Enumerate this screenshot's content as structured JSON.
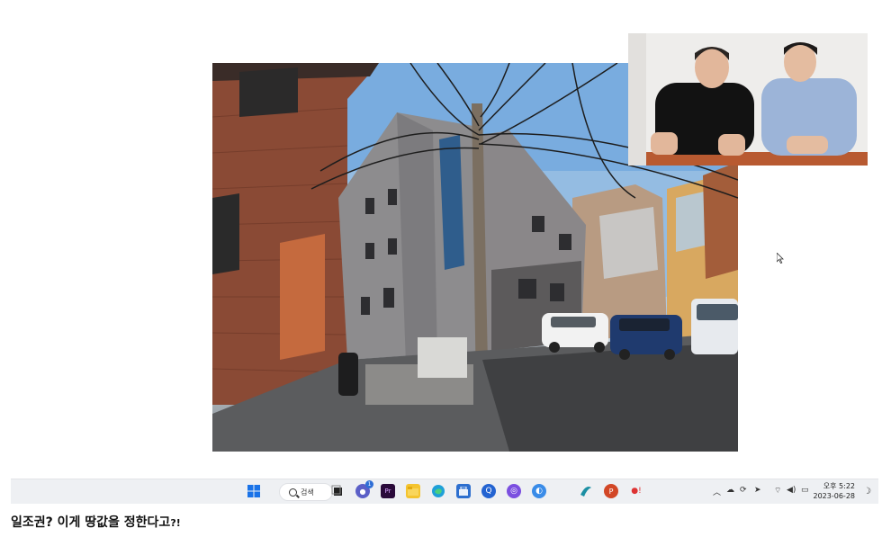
{
  "taskbar": {
    "search_label": "검색",
    "chat_badge": "1",
    "clock_time": "오후 5:22",
    "clock_date": "2023-06-28",
    "apps": [
      "windows-start",
      "search",
      "task-view",
      "chat",
      "premiere-pro",
      "file-explorer",
      "edge",
      "microsoft-store",
      "app-blue",
      "app-purple",
      "app-bluesky",
      "app-teal",
      "powerpoint",
      "app-red"
    ],
    "tray": [
      "chevron-up-icon",
      "cloud-icon",
      "sync-icon",
      "location-icon",
      "wifi-icon",
      "speaker-icon",
      "battery-icon",
      "notification-moon-icon"
    ]
  },
  "caption": {
    "main": "일조권? 이게 땅값을 정한다고",
    "tail": "?!"
  },
  "colors": {
    "sky": "#6fa6dc",
    "brick": "#8a4a35",
    "building": "#8d8c8e",
    "taskbar": "#eef0f3"
  }
}
